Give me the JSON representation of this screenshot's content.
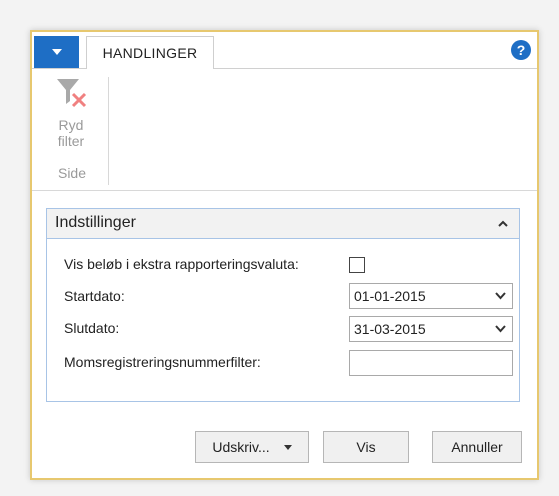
{
  "tabs": {
    "active": "HANDLINGER"
  },
  "help": {
    "glyph": "?"
  },
  "ribbon": {
    "button_label_1": "Ryd",
    "button_label_2": "filter",
    "group_label": "Side"
  },
  "fasttab": {
    "title": "Indstillinger",
    "fields": {
      "extra_currency_label": "Vis beløb i ekstra rapporteringsvaluta:",
      "extra_currency_checked": false,
      "start_label": "Startdato:",
      "start_value": "01-01-2015",
      "end_label": "Slutdato:",
      "end_value": "31-03-2015",
      "vat_label": "Momsregistreringsnummerfilter:",
      "vat_value": ""
    }
  },
  "footer": {
    "print_label": "Udskriv...",
    "view_label": "Vis",
    "cancel_label": "Annuller"
  },
  "colors": {
    "accent": "#1e6ec5",
    "frame": "#e7c86f",
    "fasttab_border": "#a8c4e6"
  }
}
